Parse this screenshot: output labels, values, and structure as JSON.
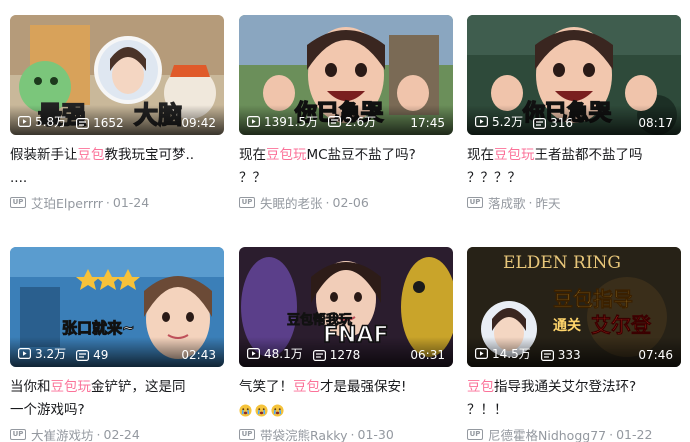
{
  "cards": [
    {
      "overlay": [
        "最强",
        "大脑"
      ],
      "views": "5.8万",
      "danmaku": "1652",
      "duration": "09:42",
      "title_pre": "假装新手让",
      "title_hl": "豆包",
      "title_post": "教我玩宝可梦..",
      "title_line2": "....",
      "author": "艾珀Elperrrr",
      "date": "01-24"
    },
    {
      "overlay": [
        "你已急哭"
      ],
      "views": "1391.5万",
      "danmaku": "2.6万",
      "duration": "17:45",
      "title_pre": "现在",
      "title_hl": "豆包玩",
      "title_post": "MC盐豆不盐了吗?",
      "title_line2": "？？",
      "author": "失眠的老张",
      "date": "02-06"
    },
    {
      "overlay": [
        "你已急哭"
      ],
      "views": "5.2万",
      "danmaku": "316",
      "duration": "08:17",
      "title_pre": "现在",
      "title_hl": "豆包玩",
      "title_post": "王者盐都不盐了吗",
      "title_line2": "？？？？",
      "author": "落成歌",
      "date": "昨天"
    },
    {
      "overlay": [
        "张口就来~"
      ],
      "views": "3.2万",
      "danmaku": "49",
      "duration": "02:43",
      "title_pre": "当你和",
      "title_hl": "豆包玩",
      "title_post": "金铲铲，这是同",
      "title_line2": "一个游戏吗?",
      "author": "大崔游戏坊",
      "date": "02-24"
    },
    {
      "overlay": [
        "豆包帮我玩",
        "FNAF"
      ],
      "views": "48.1万",
      "danmaku": "1278",
      "duration": "06:31",
      "title_pre": "气笑了！",
      "title_hl": "豆包",
      "title_post": "才是最强保安!",
      "title_line2": "",
      "author": "带袋浣熊Rakky",
      "date": "01-30"
    },
    {
      "overlay": [
        "ELDEN RING",
        "豆包指导",
        "通关",
        "艾尔登"
      ],
      "views": "14.5万",
      "danmaku": "333",
      "duration": "07:46",
      "title_pre": "",
      "title_hl": "豆包",
      "title_post": "指导我通关艾尔登法环?",
      "title_line2": "？！！",
      "author": "尼德霍格Nidhogg77",
      "date": "01-22"
    }
  ],
  "up_label": "UP",
  "colors": {
    "highlight": "#fb7299",
    "meta": "#9499a0",
    "text": "#18191c"
  }
}
